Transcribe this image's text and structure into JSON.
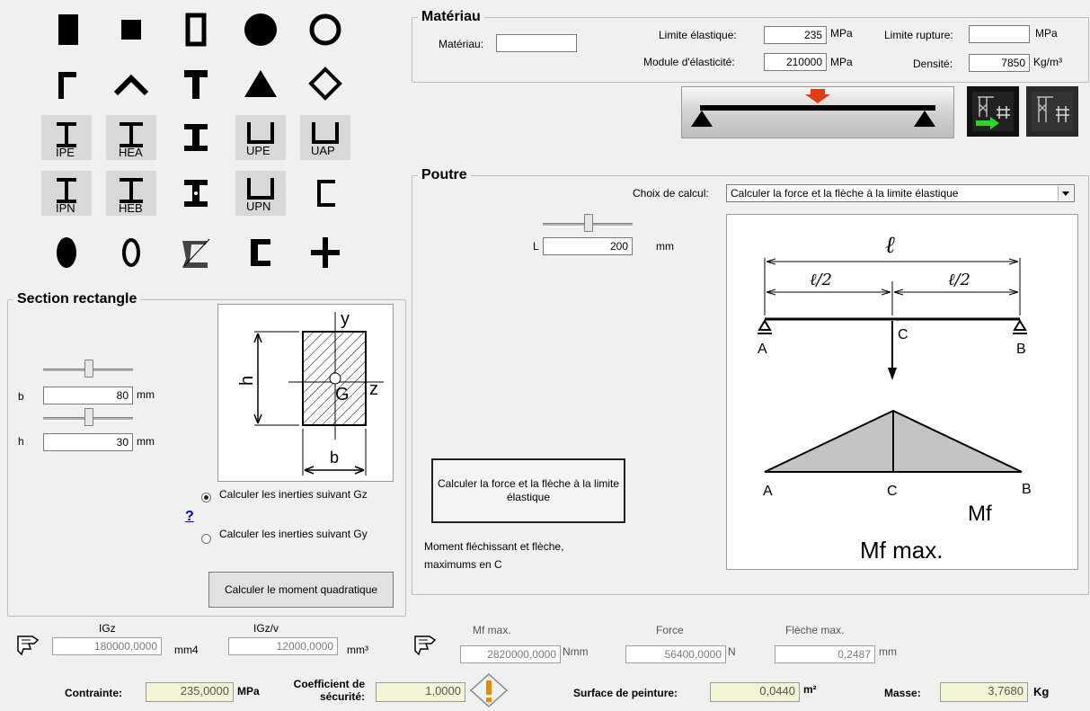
{
  "materiau": {
    "title": "Matériau",
    "materiau_label": "Matériau:",
    "materiau_value": "",
    "limite_elastique_label": "Limite élastique:",
    "limite_elastique_value": "235",
    "limite_elastique_unit": "MPa",
    "limite_rupture_label": "Limite rupture:",
    "limite_rupture_value": "",
    "limite_rupture_unit": "MPa",
    "module_label": "Module d'élasticité:",
    "module_value": "210000",
    "module_unit": "MPa",
    "densite_label": "Densité:",
    "densite_value": "7850",
    "densite_unit": "Kg/m³"
  },
  "section_grid": {
    "labels": [
      "IPE",
      "HEA",
      "UPE",
      "UAP",
      "IPN",
      "HEB",
      "UPN"
    ]
  },
  "section": {
    "title": "Section rectangle",
    "b_label": "b",
    "b_value": "80",
    "b_unit": "mm",
    "h_label": "h",
    "h_value": "30",
    "h_unit": "mm",
    "diagram": {
      "y": "y",
      "h": "h",
      "g": "G",
      "z": "z",
      "b": "b"
    },
    "radio_gz": "Calculer les inerties suivant Gz",
    "radio_gy": "Calculer les inerties suivant Gy",
    "help": "?",
    "calc_button": "Calculer le moment quadratique"
  },
  "poutre": {
    "title": "Poutre",
    "choix_label": "Choix de calcul:",
    "choix_value": "Calculer la force et la flèche à la limite élastique",
    "l_label": "L",
    "l_value": "200",
    "l_unit": "mm",
    "diagram": {
      "l": "ℓ",
      "l_half_left": "ℓ/2",
      "l_half_right": "ℓ/2",
      "a": "A",
      "b": "B",
      "c": "C",
      "a2": "A",
      "b2": "B",
      "c2": "C",
      "mf": "Mf",
      "mf_max": "Mf max."
    },
    "calc_button": "Calculer la force et la flèche à la limite élastique",
    "note": "Moment fléchissant et flèche, maximums en C"
  },
  "results": {
    "igz_label": "IGz",
    "igz_value": "180000,0000",
    "igz_unit": "mm4",
    "igzv_label": "IGz/v",
    "igzv_value": "12000,0000",
    "igzv_unit": "mm³",
    "mf_label": "Mf max.",
    "mf_value": "2820000,0000",
    "mf_unit": "Nmm",
    "force_label": "Force",
    "force_value": "56400,0000",
    "force_unit": "N",
    "fleche_label": "Flèche max.",
    "fleche_value": "0,2487",
    "fleche_unit": "mm"
  },
  "footer": {
    "contrainte_label": "Contrainte:",
    "contrainte_value": "235,0000",
    "contrainte_unit": "MPa",
    "coef_label": "Coefficient de sécurité:",
    "coef_value": "1,0000",
    "warning": "!",
    "surface_label": "Surface de peinture:",
    "surface_value": "0,0440",
    "surface_unit": "m²",
    "masse_label": "Masse:",
    "masse_value": "3,7680",
    "masse_unit": "Kg"
  }
}
